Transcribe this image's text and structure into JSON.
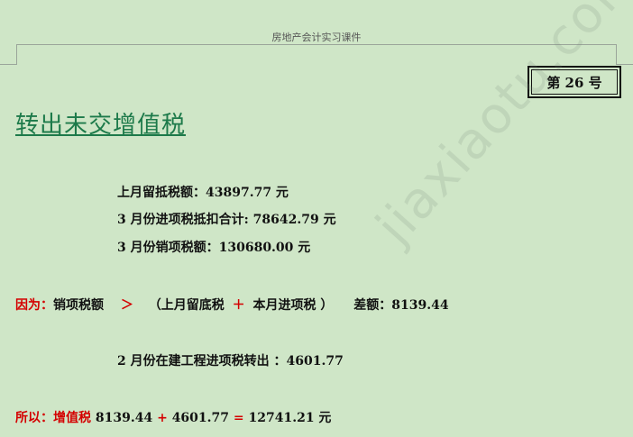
{
  "header": {
    "title": "房地产会计实习课件"
  },
  "page_badge": "第 26 号",
  "title": "转出未交增值税",
  "lines": {
    "l1": "上月留抵税额：43897.77 元",
    "l2": "3 月份进项税抵扣合计: 78642.79 元",
    "l3": "3 月份销项税额：130680.00 元"
  },
  "because": {
    "label": "因为：",
    "a": "销项税额",
    "gt": "＞",
    "b": "（上月留底税",
    "plus": "＋",
    "c": "本月进项税 ）",
    "diff": "差额：8139.44"
  },
  "transfer_line": "2 月份在建工程进项税转出 ：4601.77",
  "therefore": {
    "label": "所以：",
    "b": "增值税",
    "n1": "8139.44",
    "plus": "+",
    "n2": "4601.77",
    "eq": "=",
    "n3": "12741.21 元"
  },
  "watermark": "jiaxiaotu.com"
}
